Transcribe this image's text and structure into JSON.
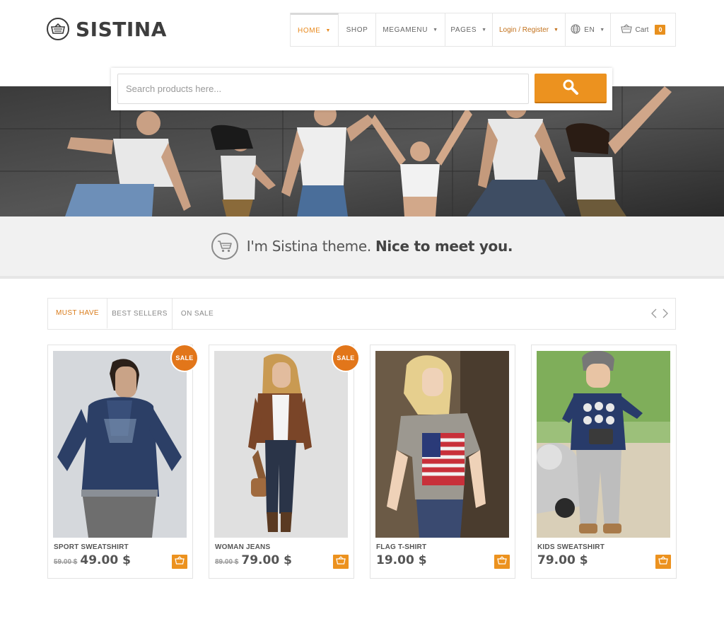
{
  "brand": {
    "name": "SISTINA"
  },
  "nav": {
    "items": [
      {
        "label": "HOME",
        "has_caret": true
      },
      {
        "label": "SHOP",
        "has_caret": false
      },
      {
        "label": "MEGAMENU",
        "has_caret": true
      },
      {
        "label": "PAGES",
        "has_caret": true
      },
      {
        "label": "Login / Register",
        "has_caret": true
      }
    ],
    "language": "EN",
    "cart_label": "Cart",
    "cart_count": "0"
  },
  "search": {
    "placeholder": "Search products here..."
  },
  "welcome": {
    "text_regular": "I'm Sistina theme.",
    "text_bold": "Nice to meet you."
  },
  "tabs": [
    "MUST HAVE",
    "BEST SELLERS",
    "ON SALE"
  ],
  "products": [
    {
      "name": "SPORT SWEATSHIRT",
      "old_price": "59.00 $",
      "price": "49.00 $",
      "badge": "SALE"
    },
    {
      "name": "WOMAN JEANS",
      "old_price": "89.00 $",
      "price": "79.00 $",
      "badge": "SALE"
    },
    {
      "name": "FLAG T-SHIRT",
      "old_price": "",
      "price": "19.00 $",
      "badge": ""
    },
    {
      "name": "KIDS SWEATSHIRT",
      "old_price": "",
      "price": "79.00 $",
      "badge": ""
    }
  ],
  "colors": {
    "accent": "#ec921f",
    "accent_dark": "#e2761a",
    "text": "#555555",
    "border": "#e5e5e5"
  },
  "icons": [
    "basket-logo-icon",
    "globe-icon",
    "cart-icon",
    "search-icon",
    "shopping-cart-icon",
    "chevron-left-icon",
    "chevron-right-icon",
    "add-to-cart-icon"
  ]
}
